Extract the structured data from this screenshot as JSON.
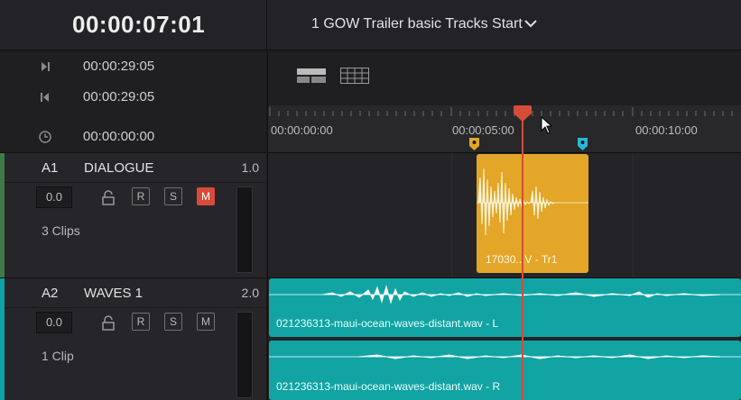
{
  "header": {
    "current_timecode": "00:00:07:01",
    "timeline_name": "1 GOW Trailer basic Tracks Start"
  },
  "info": {
    "rows": [
      {
        "icon": "go-to-end-icon",
        "timecode": "00:00:29:05"
      },
      {
        "icon": "go-to-start-icon",
        "timecode": "00:00:29:05"
      },
      {
        "icon": "clock-icon",
        "timecode": "00:00:00:00"
      }
    ]
  },
  "ruler": {
    "labels": [
      "00:00:00:00",
      "00:00:05:00",
      "00:00:10:00"
    ]
  },
  "tracks": [
    {
      "id": "A1",
      "name": "DIALOGUE",
      "level": "1.0",
      "volume": "0.0",
      "buttons": [
        "R",
        "S",
        "M"
      ],
      "mute_active": true,
      "clip_count": "3 Clips",
      "color": "#3f7a48",
      "clips": [
        {
          "label": "17030...V - Tr1",
          "color": "#e3a628"
        }
      ]
    },
    {
      "id": "A2",
      "name": "WAVES 1",
      "level": "2.0",
      "volume": "0.0",
      "buttons": [
        "R",
        "S",
        "M"
      ],
      "mute_active": false,
      "clip_count": "1 Clip",
      "color": "#0fa2a2",
      "clips": [
        {
          "label": "021236313-maui-ocean-waves-distant.wav - L",
          "color": "#12a3a3"
        },
        {
          "label": "021236313-maui-ocean-waves-distant.wav - R",
          "color": "#12a3a3"
        }
      ]
    }
  ],
  "colors": {
    "playhead": "#d74b3a",
    "mute_active": "#d74b3a",
    "marker_orange": "#e3a628",
    "marker_cyan": "#27b9d6"
  }
}
